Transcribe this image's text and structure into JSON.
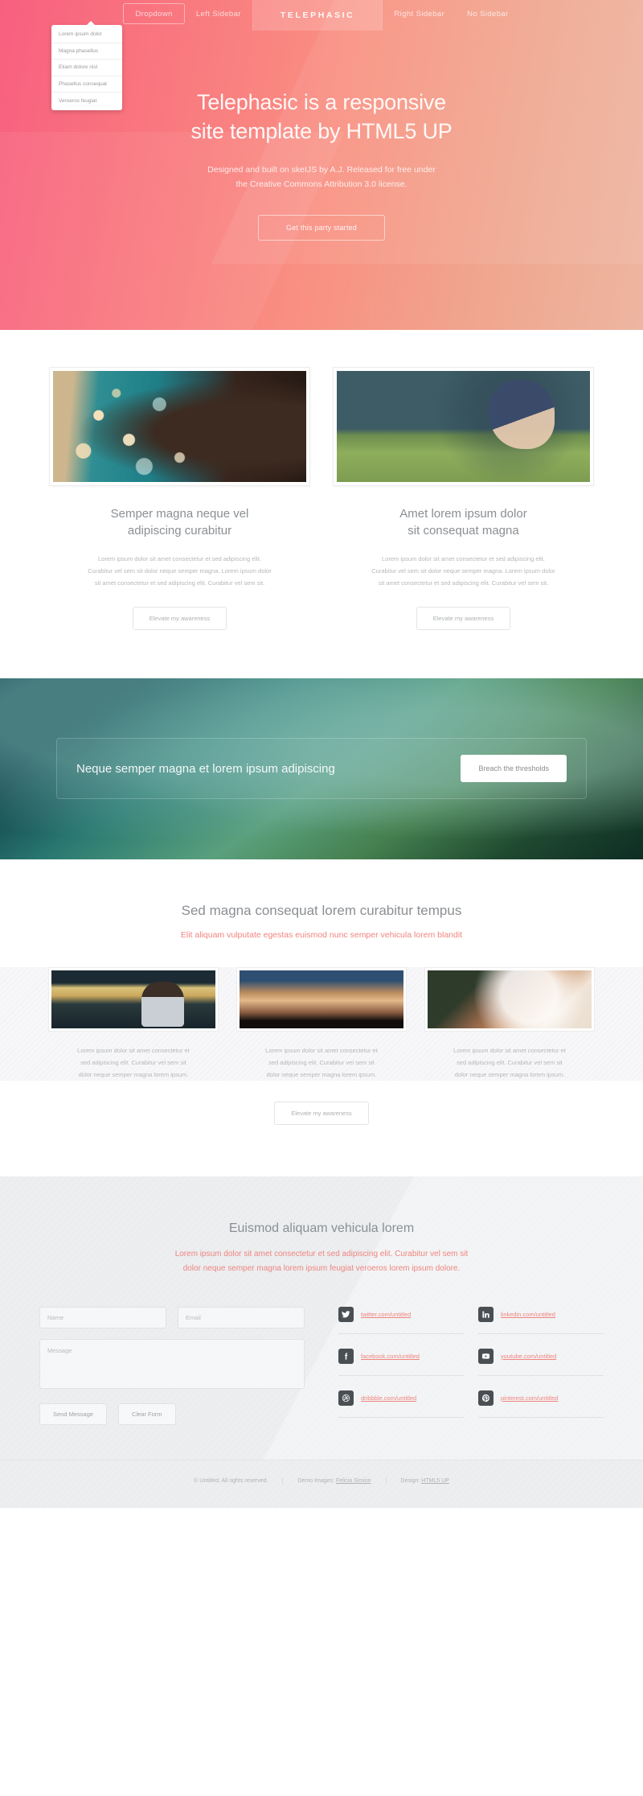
{
  "nav": {
    "items": [
      {
        "label": "Dropdown",
        "style": "boxed"
      },
      {
        "label": "Left Sidebar",
        "style": "plain"
      },
      {
        "label": "TELEPHASIC",
        "style": "brand"
      },
      {
        "label": "Right Sidebar",
        "style": "plain"
      },
      {
        "label": "No Sidebar",
        "style": "plain"
      }
    ],
    "dropdown_items": [
      {
        "label": "Lorem ipsum dolor"
      },
      {
        "label": "Magna phasellus"
      },
      {
        "label": "Etiam dolore nisl"
      },
      {
        "label": "Phasellus consequat"
      },
      {
        "label": "Veroeros feugiat"
      }
    ]
  },
  "hero": {
    "heading_line1": "Telephasic is a responsive",
    "heading_line2": "site template by HTML5 UP",
    "paragraph_line1": "Designed and built on skeIJS by A.J. Released for free under",
    "paragraph_line2": "the Creative Commons Attribution 3.0 license.",
    "button": "Get this party started",
    "gradient_start": "#f8607f",
    "gradient_end": "#edb6a0"
  },
  "features": [
    {
      "title_line1": "Semper magna neque vel",
      "title_line2": "adipiscing curabitur",
      "body_line1": "Lorem ipsum dolor sit amet consectetur et sed adipiscing elit.",
      "body_line2": "Curabitur vel sem sit dolor neque semper magna. Lorem ipsum dolor",
      "body_line3": "sit amet consectetur et sed adipiscing elit. Curabitur vel sem sit.",
      "button": "Elevate my awareness",
      "image": "man-blowing-bubbles-photo"
    },
    {
      "title_line1": "Amet lorem ipsum dolor",
      "title_line2": "sit consequat magna",
      "body_line1": "Lorem ipsum dolor sit amet consectetur et sed adipiscing elit.",
      "body_line2": "Curabitur vel sem sit dolor neque semper magna. Lorem ipsum dolor",
      "body_line3": "sit amet consectetur et sed adipiscing elit. Curabitur vel sem sit.",
      "button": "Elevate my awareness",
      "image": "woman-in-field-photo"
    }
  ],
  "banner": {
    "text": "Neque semper magna et lorem ipsum adipiscing",
    "button": "Breach the thresholds"
  },
  "gallery": {
    "title": "Sed magna consequat lorem curabitur tempus",
    "subtitle": "Elit aliquam vulputate egestas euismod nunc semper vehicula lorem blandit",
    "items": [
      {
        "image": "train-station-photo",
        "body_line1": "Lorem ipsum dolor sit amet consectetur et",
        "body_line2": "sed adipiscing elit. Curabitur vel sem sit",
        "body_line3": "dolor neque semper magna lorem ipsum."
      },
      {
        "image": "wind-turbines-photo",
        "body_line1": "Lorem ipsum dolor sit amet consectetur et",
        "body_line2": "sed adipiscing elit. Curabitur vel sem sit",
        "body_line3": "dolor neque semper magna lorem ipsum."
      },
      {
        "image": "woman-with-flowers-photo",
        "body_line1": "Lorem ipsum dolor sit amet consectetur et",
        "body_line2": "sed adipiscing elit. Curabitur vel sem sit",
        "body_line3": "dolor neque semper magna lorem ipsum."
      }
    ],
    "button": "Elevate my awareness"
  },
  "contact": {
    "title": "Euismod aliquam vehicula lorem",
    "subtitle_line1": "Lorem ipsum dolor sit amet consectetur et sed adipiscing elit. Curabitur vel sem sit",
    "subtitle_line2": "dolor neque semper magna lorem ipsum feugiat veroeros lorem ipsum dolore.",
    "form": {
      "name_placeholder": "Name",
      "email_placeholder": "Email",
      "message_placeholder": "Message",
      "send_label": "Send Message",
      "clear_label": "Clear Form"
    },
    "social": [
      {
        "icon": "twitter-icon",
        "glyph": "twitter",
        "label": "twitter.com/untitled"
      },
      {
        "icon": "linkedin-icon",
        "glyph": "in",
        "label": "linkedin.com/untitled"
      },
      {
        "icon": "facebook-icon",
        "glyph": "f",
        "label": "facebook.com/untitled"
      },
      {
        "icon": "youtube-icon",
        "glyph": "youtube",
        "label": "youtube.com/untitled"
      },
      {
        "icon": "dribbble-icon",
        "glyph": "dribbble",
        "label": "dribbble.com/untitled"
      },
      {
        "icon": "pinterest-icon",
        "glyph": "P",
        "label": "pinterest.com/untitled"
      }
    ],
    "accent_color": "#f0857f"
  },
  "footer": {
    "copyright": "© Untitled. All rights reserved.",
    "demo_label": "Demo Images:",
    "demo_link": "Felicia Simion",
    "design_label": "Design:",
    "design_link": "HTML5 UP"
  }
}
